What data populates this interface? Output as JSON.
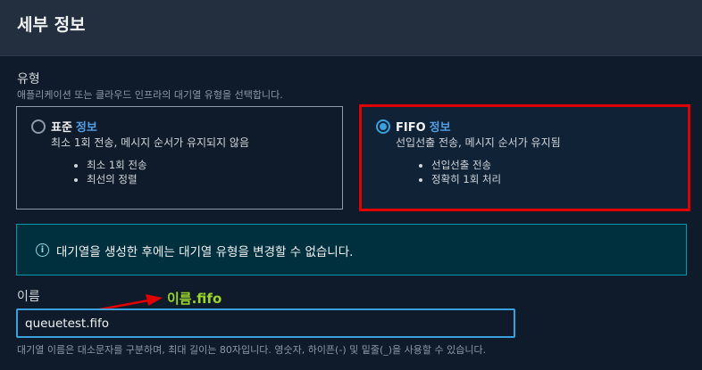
{
  "header": {
    "title": "세부 정보"
  },
  "type_section": {
    "label": "유형",
    "description": "애플리케이션 또는 클라우드 인프라의 대기열 유형을 선택합니다.",
    "options": [
      {
        "title": "표준",
        "info": "정보",
        "subtitle": "최소 1회 전송, 메시지 순서가 유지되지 않음",
        "bullets": [
          "최소 1회 전송",
          "최선의 정렬"
        ],
        "selected": false
      },
      {
        "title": "FIFO",
        "info": "정보",
        "subtitle": "선입선출 전송, 메시지 순서가 유지됨",
        "bullets": [
          "선입선출 전송",
          "정확히 1회 처리"
        ],
        "selected": true
      }
    ]
  },
  "alert": {
    "icon": "info-icon",
    "text": "대기열을 생성한 후에는 대기열 유형을 변경할 수 없습니다."
  },
  "name_field": {
    "label": "이름",
    "value": "queuetest.fifo",
    "hint": "대기열 이름은 대소문자를 구분하며, 최대 길이는 80자입니다. 영숫자, 하이픈(-) 및 밑줄(_)을 사용할 수 있습니다."
  },
  "annotation": {
    "text": "이름.fifo",
    "color": "#9bd62a",
    "arrow_color": "#e00000"
  },
  "colors": {
    "background": "#0f1b2a",
    "accent": "#3aa1dd",
    "highlight_outline": "#e00000",
    "alert_border": "#0399a8"
  }
}
